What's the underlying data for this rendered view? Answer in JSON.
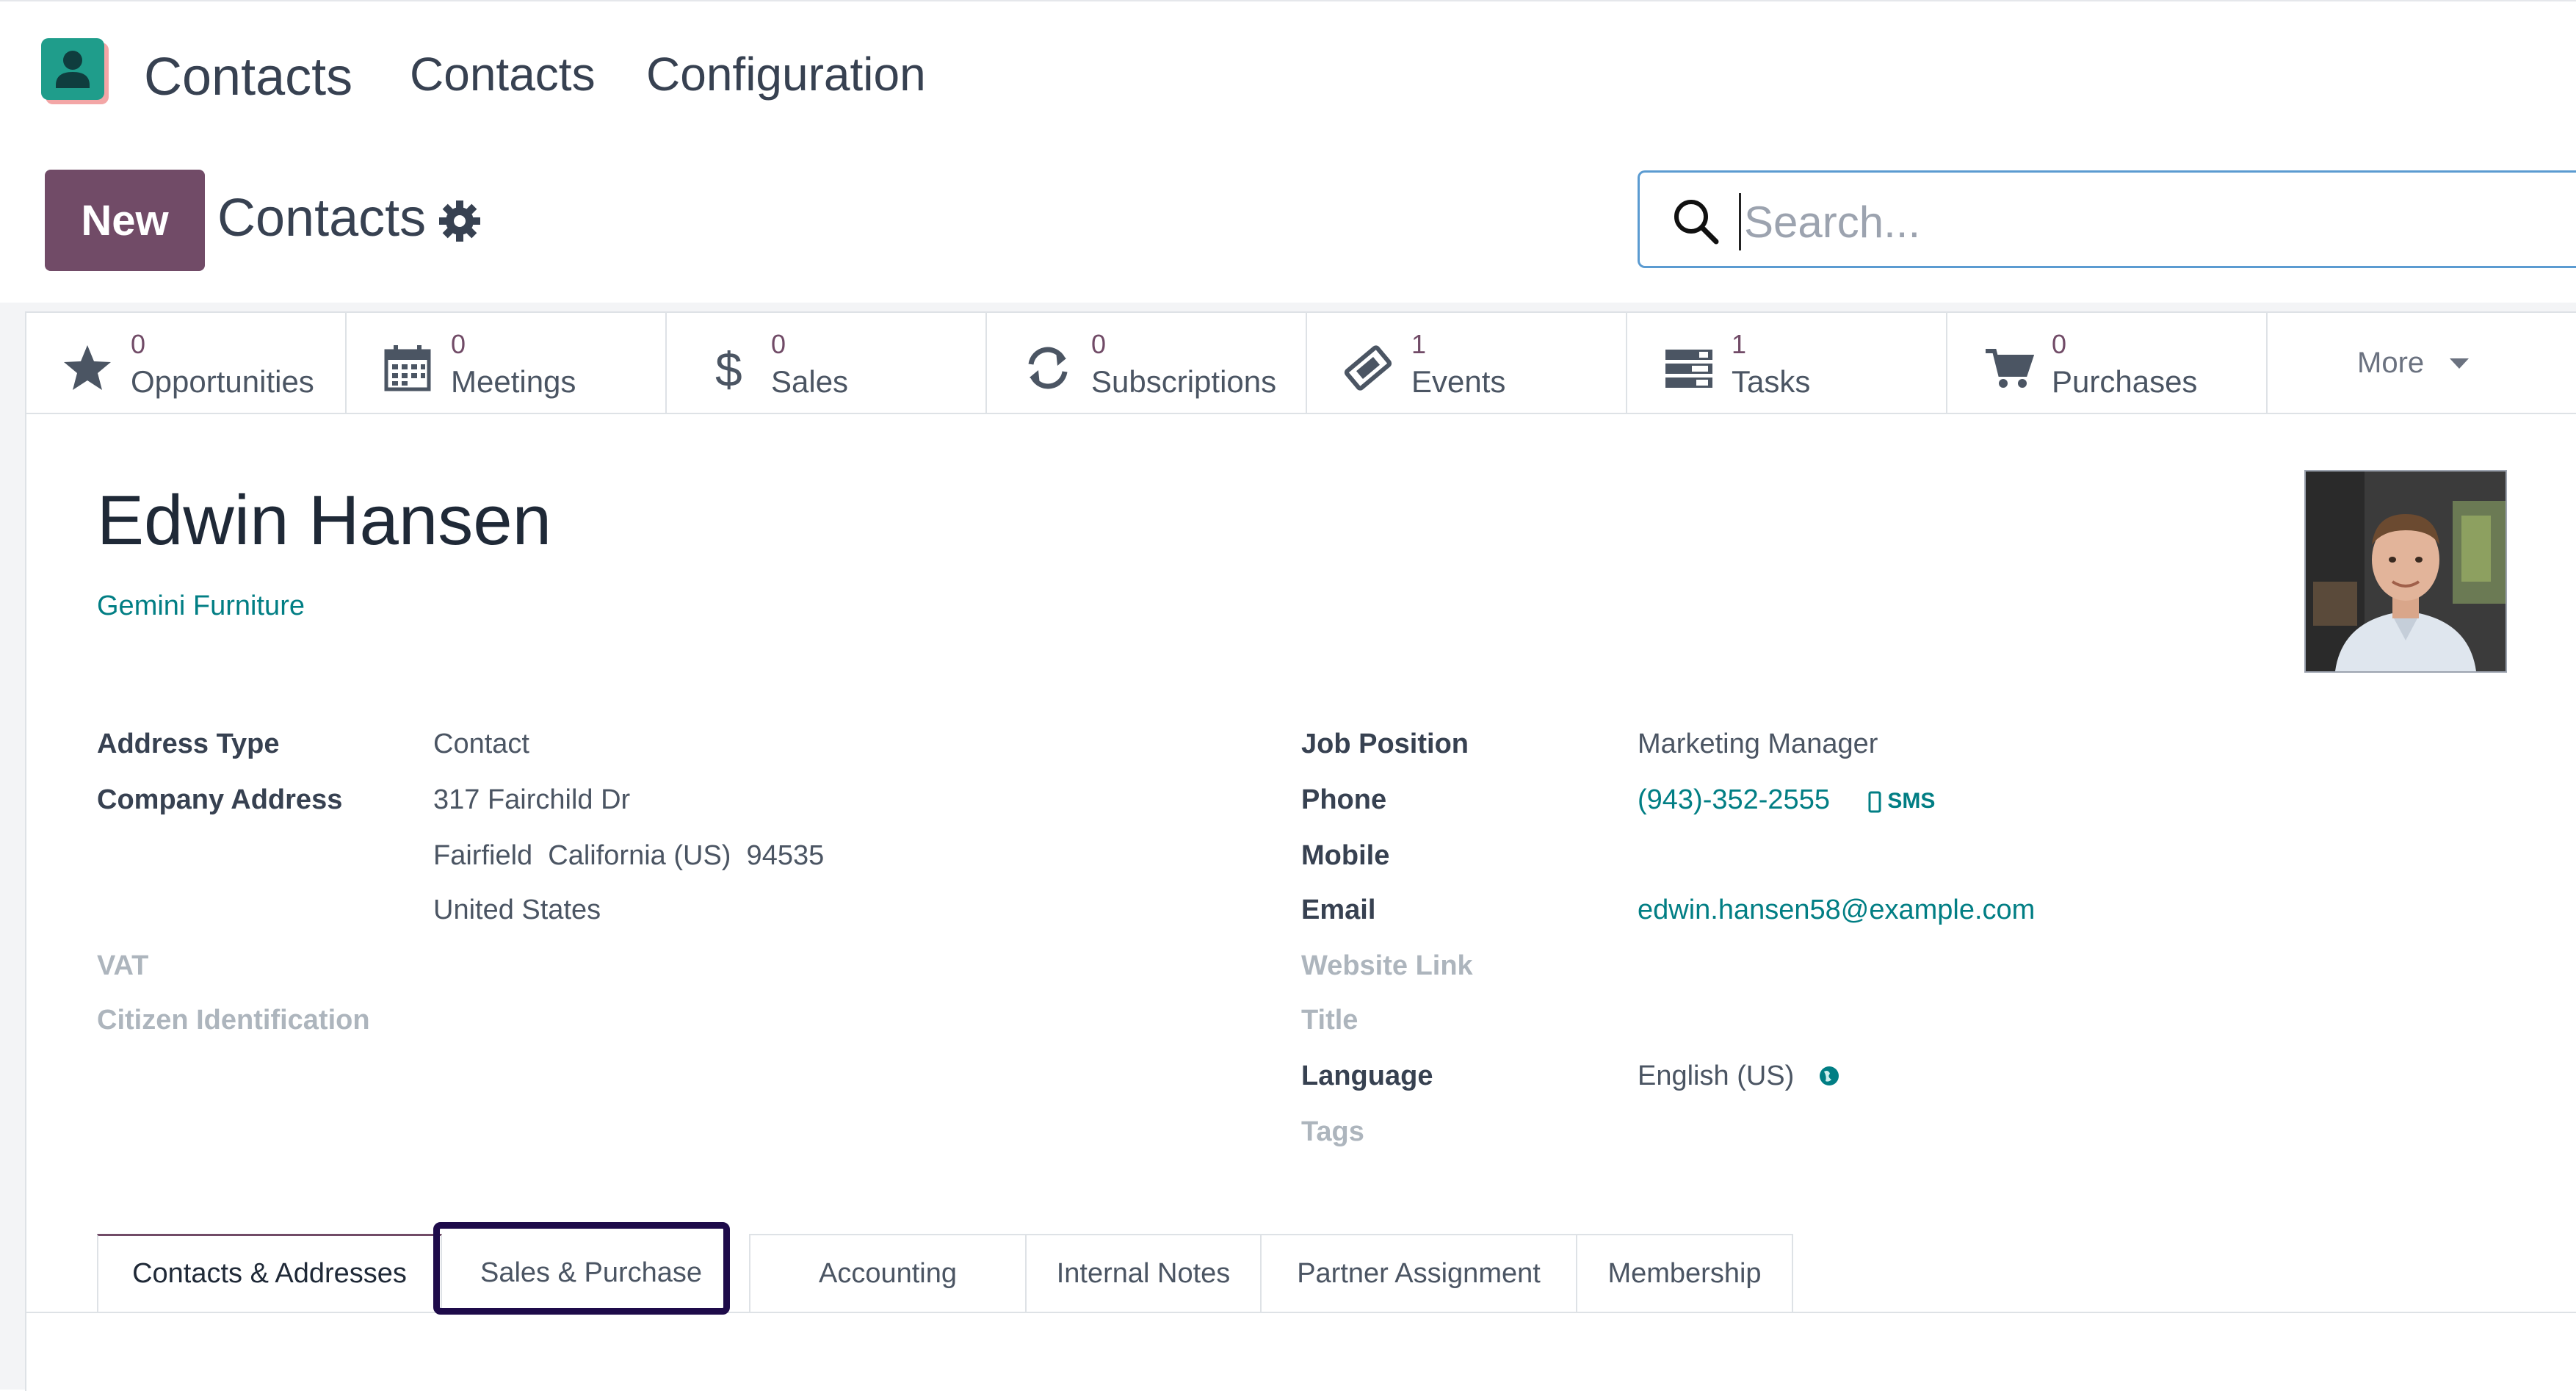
{
  "app": {
    "name": "Contacts",
    "brand_color": "#714B67",
    "link_color": "#017e84"
  },
  "menu": [
    {
      "label": "Contacts"
    },
    {
      "label": "Configuration"
    }
  ],
  "control": {
    "new_label": "New",
    "breadcrumb": "Contacts"
  },
  "search": {
    "placeholder": "Search..."
  },
  "stats": [
    {
      "icon": "star-icon",
      "count": "0",
      "label": "Opportunities"
    },
    {
      "icon": "calendar-icon",
      "count": "0",
      "label": "Meetings"
    },
    {
      "icon": "dollar-icon",
      "count": "0",
      "label": "Sales"
    },
    {
      "icon": "refresh-icon",
      "count": "0",
      "label": "Subscriptions"
    },
    {
      "icon": "ticket-icon",
      "count": "1",
      "label": "Events"
    },
    {
      "icon": "tasks-icon",
      "count": "1",
      "label": "Tasks"
    },
    {
      "icon": "cart-icon",
      "count": "0",
      "label": "Purchases"
    }
  ],
  "more_label": "More",
  "contact": {
    "name": "Edwin Hansen",
    "company": "Gemini Furniture"
  },
  "left_fields": {
    "address_type": {
      "label": "Address Type",
      "value": "Contact"
    },
    "company_address": {
      "label": "Company Address",
      "line1": "317 Fairchild Dr",
      "line2": "Fairfield  California (US)  94535",
      "line3": "United States"
    },
    "vat": {
      "label": "VAT"
    },
    "citizen_id": {
      "label": "Citizen Identification"
    }
  },
  "right_fields": {
    "job_position": {
      "label": "Job Position",
      "value": "Marketing Manager"
    },
    "phone": {
      "label": "Phone",
      "value": "(943)-352-2555",
      "sms": "SMS"
    },
    "mobile": {
      "label": "Mobile"
    },
    "email": {
      "label": "Email",
      "value": "edwin.hansen58@example.com"
    },
    "website": {
      "label": "Website Link"
    },
    "title": {
      "label": "Title"
    },
    "language": {
      "label": "Language",
      "value": "English (US)"
    },
    "tags": {
      "label": "Tags"
    }
  },
  "tabs": [
    {
      "label": "Contacts & Addresses",
      "active": true
    },
    {
      "label": "Sales & Purchase",
      "active": false
    },
    {
      "label": "Accounting",
      "active": false
    },
    {
      "label": "Internal Notes",
      "active": false
    },
    {
      "label": "Partner Assignment",
      "active": false
    },
    {
      "label": "Membership",
      "active": false
    }
  ]
}
